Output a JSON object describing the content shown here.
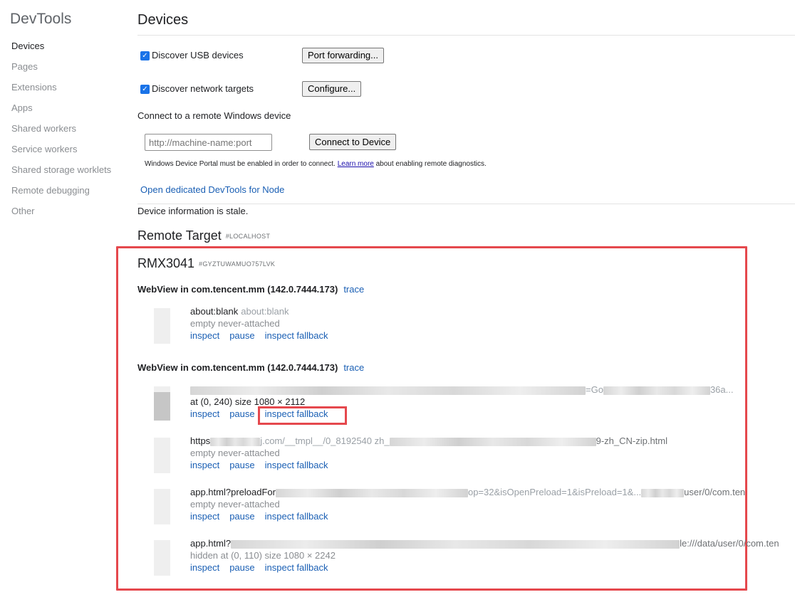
{
  "app": {
    "title": "DevTools"
  },
  "sidebar": {
    "items": [
      {
        "label": "Devices",
        "active": true
      },
      {
        "label": "Pages"
      },
      {
        "label": "Extensions"
      },
      {
        "label": "Apps"
      },
      {
        "label": "Shared workers"
      },
      {
        "label": "Service workers"
      },
      {
        "label": "Shared storage worklets"
      },
      {
        "label": "Remote debugging"
      },
      {
        "label": "Other"
      }
    ]
  },
  "devices": {
    "title": "Devices",
    "discover_usb": {
      "label": "Discover USB devices",
      "checked": true
    },
    "port_forwarding_button": "Port forwarding...",
    "discover_network": {
      "label": "Discover network targets",
      "checked": true
    },
    "configure_button": "Configure...",
    "connect_remote_label": "Connect to a remote Windows device",
    "remote_input_placeholder": "http://machine-name:port",
    "connect_button": "Connect to Device",
    "portal_note_before": "Windows Device Portal must be enabled in order to connect.",
    "learn_more": "Learn more",
    "portal_note_after": "about enabling remote diagnostics.",
    "node_link": "Open dedicated DevTools for Node",
    "stale_notice": "Device information is stale."
  },
  "remote_target": {
    "title": "Remote Target",
    "tag": "#LOCALHOST",
    "device_name": "RMX3041",
    "device_id": "#GYZTUWAMUO757LVK",
    "webview_1": {
      "title": "WebView in com.tencent.mm (142.0.7444.173)",
      "trace": "trace",
      "pages": [
        {
          "title": "about:blank",
          "url": "about:blank",
          "desc": "empty never-attached"
        }
      ]
    },
    "webview_2": {
      "title": "WebView in com.tencent.mm (142.0.7444.173)",
      "trace": "trace",
      "pages": [
        {
          "title_tail": "=Go",
          "title_end": "36a...",
          "desc": "at (0, 240)  size 1080 × 2112"
        },
        {
          "title_head": "https",
          "title_mid": "j.com/__tmpl__/0_8192540 zh_",
          "title_end": "9-zh_CN-zip.html",
          "desc": "empty never-attached"
        },
        {
          "title_head": "app.html?preloadFor",
          "title_mid": "op=32&isOpenPreload=1&isPreload=1&...",
          "title_end": "user/0/com.ten",
          "desc": "empty never-attached"
        },
        {
          "title_head": "app.html?",
          "title_mid": "",
          "title_end": "le:///data/user/0/com.ten",
          "desc": "hidden  at (0, 110)  size 1080 × 2242"
        }
      ]
    },
    "actions": {
      "inspect": "inspect",
      "pause": "pause",
      "inspect_fallback": "inspect fallback"
    }
  }
}
